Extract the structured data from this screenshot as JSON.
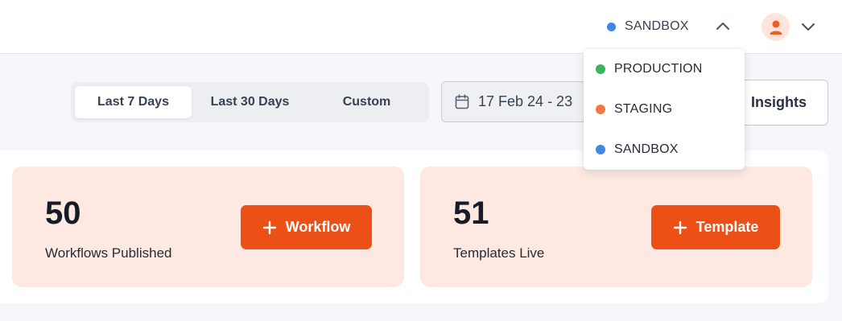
{
  "header": {
    "environment": {
      "label": "SANDBOX",
      "color": "#3f87e0"
    },
    "env_toggle_icon": "chevron-up-icon",
    "user_avatar_icon": "user-icon",
    "user_menu_icon": "chevron-down-icon"
  },
  "environment_menu": {
    "items": [
      {
        "label": "PRODUCTION",
        "color": "#3cb35e"
      },
      {
        "label": "STAGING",
        "color": "#ef7a45"
      },
      {
        "label": "SANDBOX",
        "color": "#3f87e0"
      }
    ]
  },
  "filters": {
    "ranges": [
      "Last 7 Days",
      "Last 30 Days",
      "Custom"
    ],
    "selected": "Last 7 Days",
    "date_range": "17 Feb 24 - 23",
    "calendar_icon": "calendar-icon"
  },
  "insights_label": "Insights",
  "cards": [
    {
      "value": "50",
      "label": "Workflows Published",
      "button_label": "Workflow"
    },
    {
      "value": "51",
      "label": "Templates Live",
      "button_label": "Template"
    }
  ],
  "colors": {
    "accent": "#ec5017",
    "card_background": "#fde9e2"
  }
}
